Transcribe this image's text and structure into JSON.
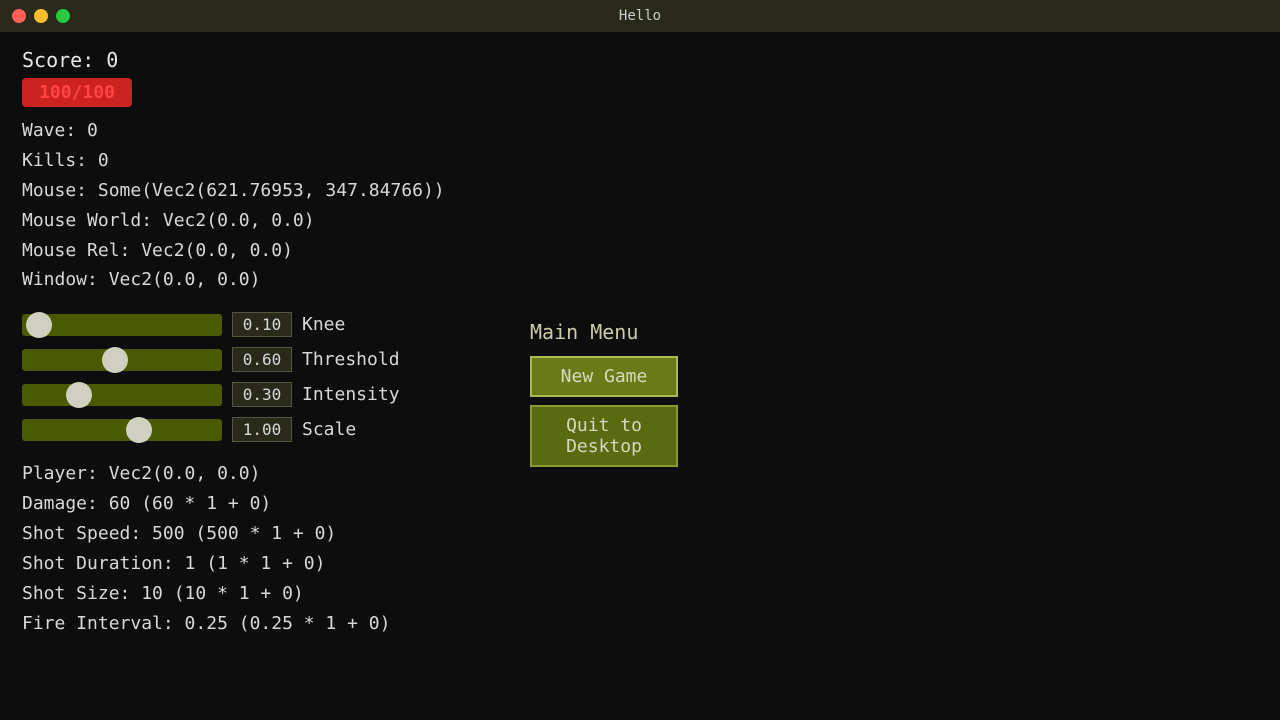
{
  "titlebar": {
    "title": "Hello"
  },
  "hud": {
    "score_label": "Score: 0",
    "health_display": "100/100",
    "wave_label": "Wave: 0",
    "kills_label": "Kills: 0",
    "mouse_label": "Mouse: Some(Vec2(621.76953, 347.84766))",
    "mouse_world_label": "Mouse World: Vec2(0.0, 0.0)",
    "mouse_rel_label": "Mouse Rel: Vec2(0.0, 0.0)",
    "window_label": "Window: Vec2(0.0, 0.0)"
  },
  "sliders": [
    {
      "id": "knee",
      "label": "Knee",
      "value": "0.10",
      "thumb_percent": 2
    },
    {
      "id": "threshold",
      "label": "Threshold",
      "value": "0.60",
      "thumb_percent": 40
    },
    {
      "id": "intensity",
      "label": "Intensity",
      "value": "0.30",
      "thumb_percent": 25
    },
    {
      "id": "scale",
      "label": "Scale",
      "value": "1.00",
      "thumb_percent": 55
    }
  ],
  "main_menu": {
    "title": "Main Menu",
    "new_game_label": "New Game",
    "quit_label": "Quit to Desktop"
  },
  "stats": {
    "player": "Player: Vec2(0.0, 0.0)",
    "damage": "Damage: 60 (60 * 1 + 0)",
    "shot_speed": "Shot Speed: 500 (500 * 1 + 0)",
    "shot_duration": "Shot Duration: 1 (1 * 1 + 0)",
    "shot_size": "Shot Size: 10 (10 * 1 + 0)",
    "fire_interval": "Fire Interval: 0.25 (0.25 * 1 + 0)"
  }
}
